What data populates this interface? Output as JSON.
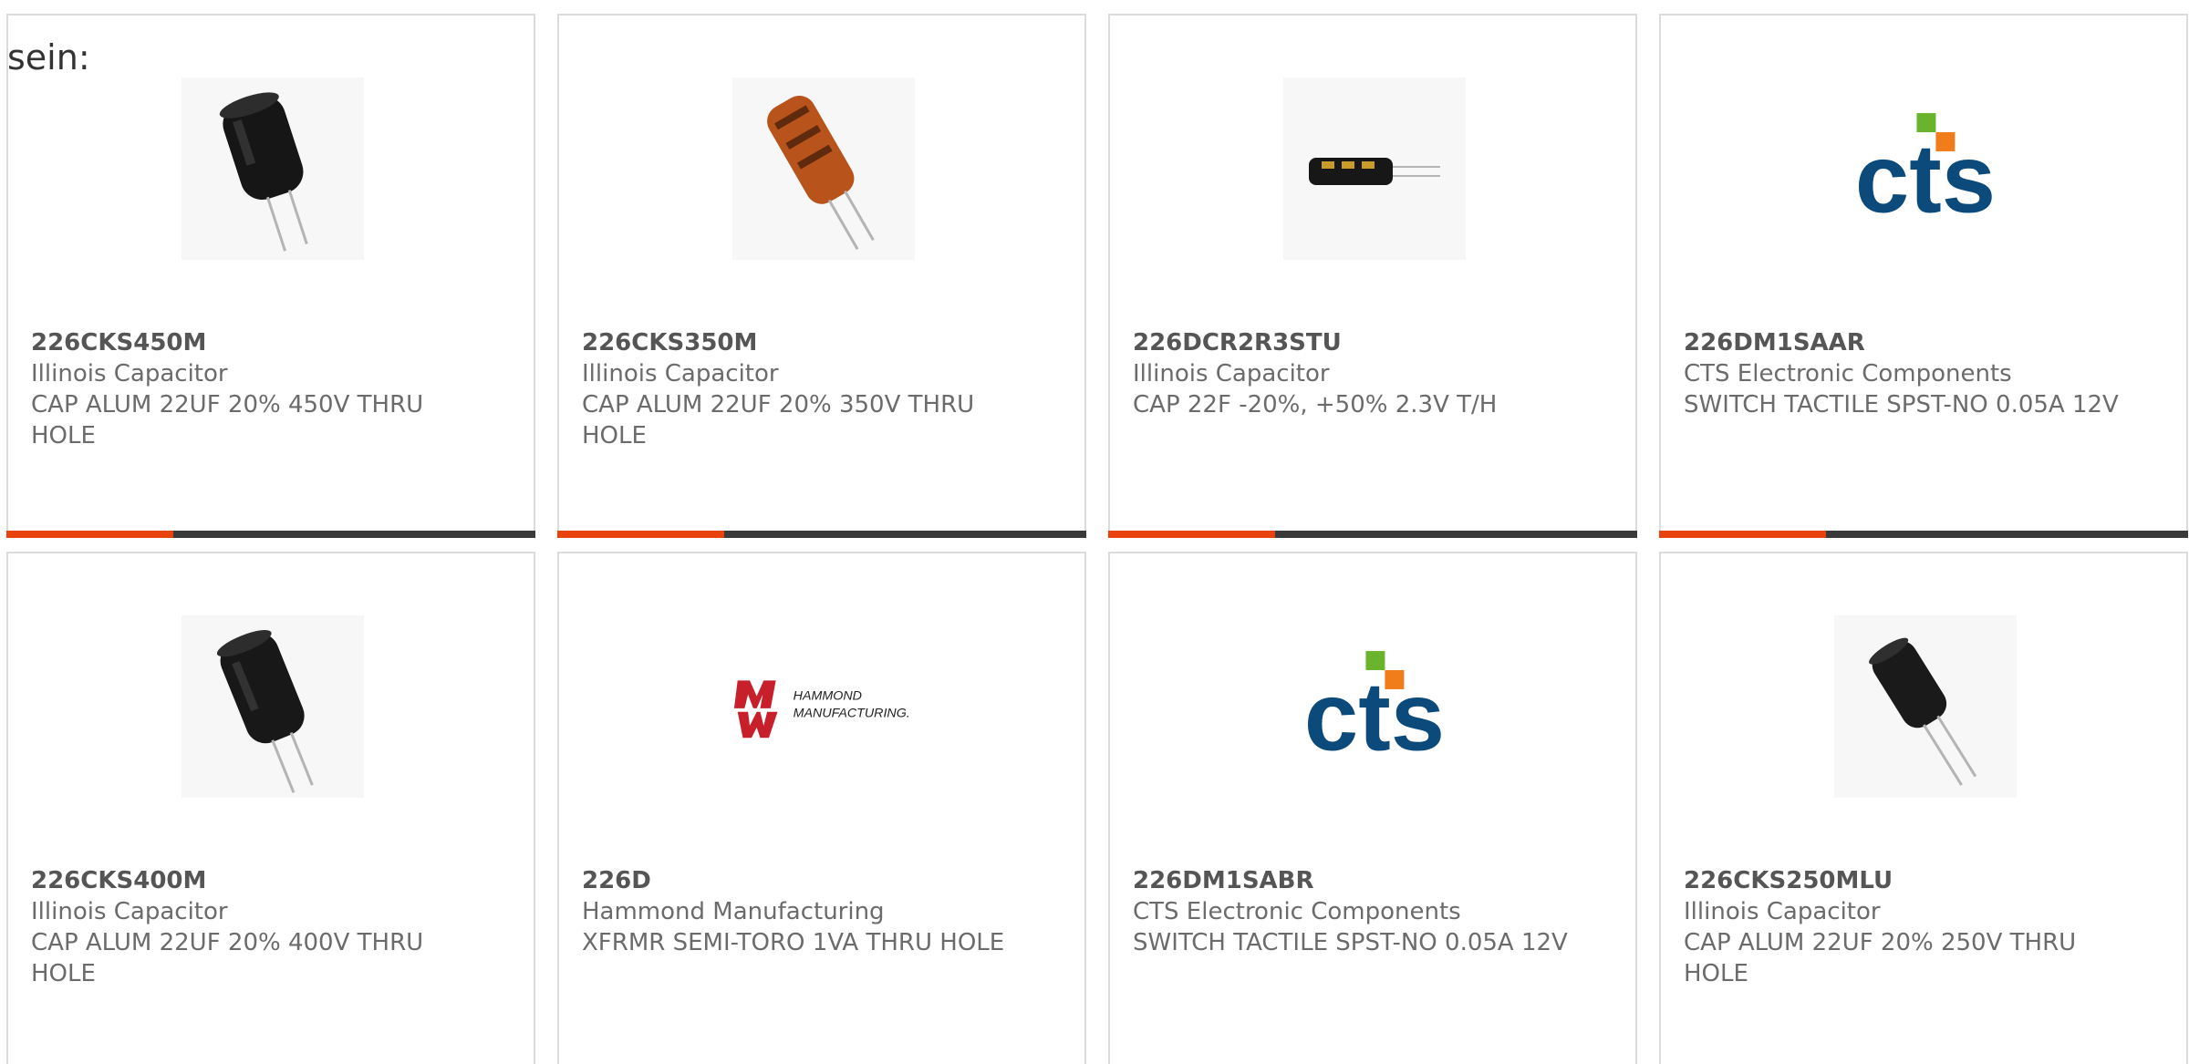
{
  "intro": "sein:",
  "products": [
    {
      "part": "226CKS450M",
      "manufacturer": "Illinois Capacitor",
      "description": "CAP ALUM 22UF 20% 450V THRU HOLE",
      "image": "black-radial-capacitor"
    },
    {
      "part": "226CKS350M",
      "manufacturer": "Illinois Capacitor",
      "description": "CAP ALUM 22UF 20% 350V THRU HOLE",
      "image": "orange-radial-capacitor"
    },
    {
      "part": "226DCR2R3STU",
      "manufacturer": "Illinois Capacitor",
      "description": "CAP 22F -20%, +50% 2.3V T/H",
      "image": "small-axial-supercapacitor"
    },
    {
      "part": "226DM1SAAR",
      "manufacturer": "CTS Electronic Components",
      "description": "SWITCH TACTILE SPST-NO 0.05A 12V",
      "image": "cts-logo"
    },
    {
      "part": "226CKS400M",
      "manufacturer": "Illinois Capacitor",
      "description": "CAP ALUM 22UF 20% 400V THRU HOLE",
      "image": "black-radial-capacitor"
    },
    {
      "part": "226D",
      "manufacturer": "Hammond Manufacturing",
      "description": "XFRMR SEMI-TORO 1VA THRU HOLE",
      "image": "hammond-logo"
    },
    {
      "part": "226DM1SABR",
      "manufacturer": "CTS Electronic Components",
      "description": "SWITCH TACTILE SPST-NO 0.05A 12V",
      "image": "cts-logo"
    },
    {
      "part": "226CKS250MLU",
      "manufacturer": "Illinois Capacitor",
      "description": "CAP ALUM 22UF 20% 250V THRU HOLE",
      "image": "black-radial-capacitor"
    }
  ],
  "logos": {
    "cts_text": "cts",
    "hammond_line1": "HAMMOND",
    "hammond_line2": "MANUFACTURING."
  },
  "colors": {
    "accent": "#e8420e",
    "bar": "#3a3a3a",
    "cts_blue": "#0b4a7a",
    "cts_green": "#6ab42d",
    "cts_orange": "#f07d1a",
    "hammond_red": "#c8202a"
  }
}
